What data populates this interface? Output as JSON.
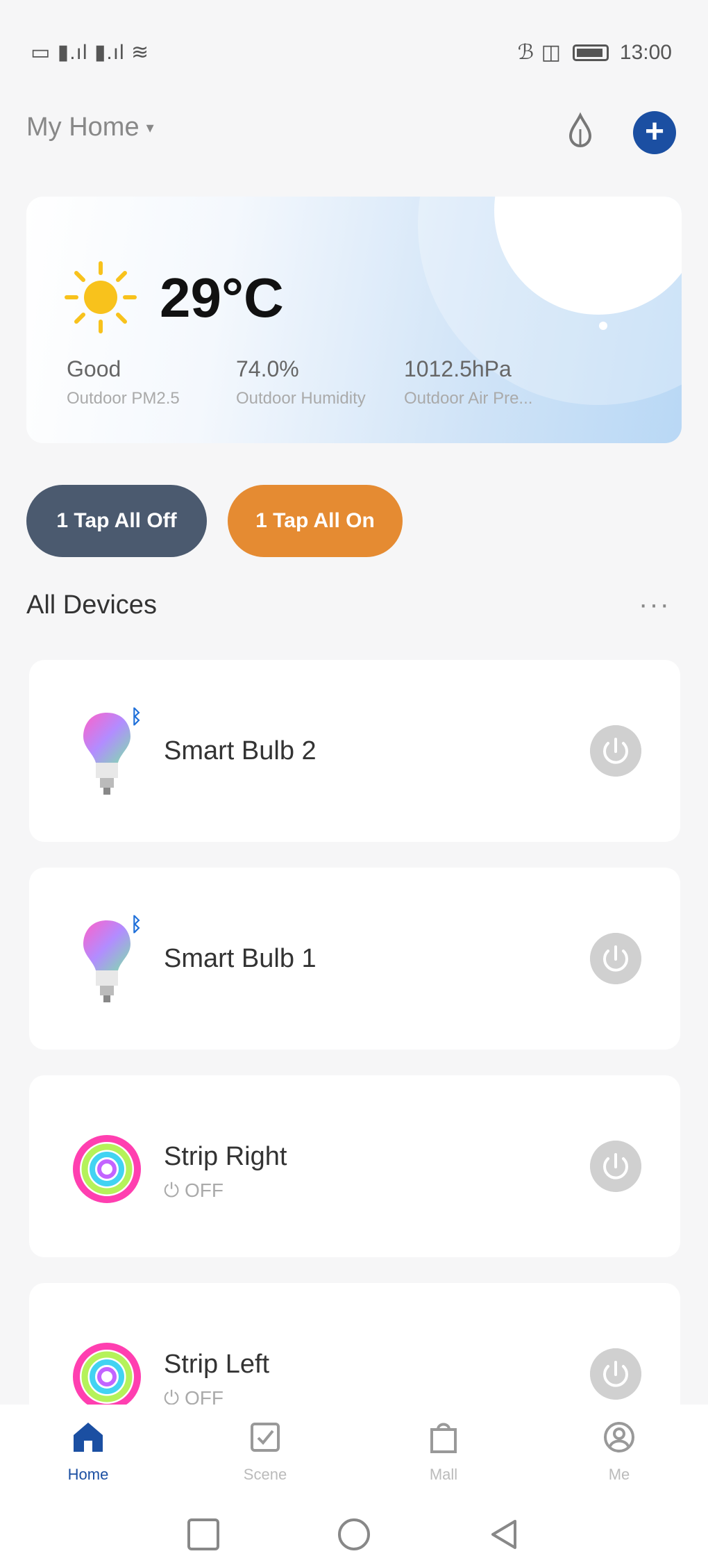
{
  "status_bar": {
    "left_glyphs": "▭ ▮.ıl ▮.ıl ≋",
    "right_glyphs": "ℬ ◫",
    "time": "13:00"
  },
  "header": {
    "home_name": "My Home",
    "caret": "▾",
    "add_label": "+"
  },
  "weather": {
    "temperature": "29°C",
    "metrics": [
      {
        "value": "Good",
        "label": "Outdoor PM2.5"
      },
      {
        "value": "74.0%",
        "label": "Outdoor Humidity"
      },
      {
        "value": "1012.5hPa",
        "label": "Outdoor Air Pre..."
      }
    ]
  },
  "quick_actions": {
    "all_off": "1 Tap All Off",
    "all_on": "1 Tap All On"
  },
  "devices_section": {
    "title": "All Devices",
    "more": "···"
  },
  "devices": [
    {
      "name": "Smart Bulb 2",
      "status": "",
      "type": "bulb",
      "badge": "ᛒ"
    },
    {
      "name": "Smart Bulb 1",
      "status": "",
      "type": "bulb",
      "badge": "ᛒ"
    },
    {
      "name": "Strip Right",
      "status": "OFF",
      "type": "strip",
      "badge": ""
    },
    {
      "name": "Strip Left",
      "status": "OFF",
      "type": "strip",
      "badge": ""
    }
  ],
  "bottom_nav": {
    "items": [
      {
        "label": "Home",
        "icon": "home-icon",
        "active": true
      },
      {
        "label": "Scene",
        "icon": "scene-icon",
        "active": false
      },
      {
        "label": "Mall",
        "icon": "mall-icon",
        "active": false
      },
      {
        "label": "Me",
        "icon": "me-icon",
        "active": false
      }
    ]
  },
  "colors": {
    "accent": "#1b4fa2",
    "all_off": "#4b5a6f",
    "all_on": "#e58b32"
  }
}
